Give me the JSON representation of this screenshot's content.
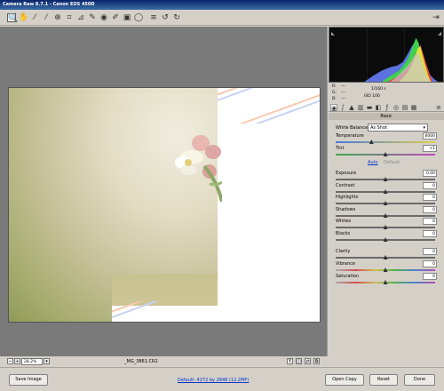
{
  "window": {
    "title": "Camera Raw 8.7.1  -  Canon EOS 450D"
  },
  "toolbar": {
    "tools": [
      {
        "name": "zoom-tool-icon",
        "glyph": "🔍"
      },
      {
        "name": "hand-tool-icon",
        "glyph": "✋"
      },
      {
        "name": "white-balance-tool-icon",
        "glyph": "⁄"
      },
      {
        "name": "color-sampler-tool-icon",
        "glyph": "⁄"
      },
      {
        "name": "target-adjustment-tool-icon",
        "glyph": "⊕"
      },
      {
        "name": "crop-tool-icon",
        "glyph": "⌗"
      },
      {
        "name": "straighten-tool-icon",
        "glyph": "⊿"
      },
      {
        "name": "spot-removal-tool-icon",
        "glyph": "✎"
      },
      {
        "name": "red-eye-tool-icon",
        "glyph": "◉"
      },
      {
        "name": "adjustment-brush-icon",
        "glyph": "✐"
      },
      {
        "name": "graduated-filter-icon",
        "glyph": "▣"
      },
      {
        "name": "radial-filter-icon",
        "glyph": "◯"
      },
      {
        "name": "preferences-icon",
        "glyph": "≡"
      },
      {
        "name": "rotate-ccw-icon",
        "glyph": "↺"
      },
      {
        "name": "rotate-cw-icon",
        "glyph": "↻"
      }
    ],
    "open_preview_icon": "⇥"
  },
  "readout": {
    "r_label": "R:",
    "g_label": "G:",
    "b_label": "B:",
    "r_value": "---",
    "g_value": "---",
    "b_value": "---",
    "shutter": "1/160 s",
    "iso": "ISO 100"
  },
  "panel": {
    "title": "Basic",
    "white_balance_label": "White Balance:",
    "white_balance_value": "As Shot",
    "auto_label": "Auto",
    "default_label": "Default",
    "sliders": [
      {
        "label": "Temperature",
        "value": "6000",
        "pos": 0.36
      },
      {
        "label": "Tint",
        "value": "+1",
        "pos": 0.5
      },
      {
        "label": "Exposure",
        "value": "0.00",
        "pos": 0.5
      },
      {
        "label": "Contrast",
        "value": "0",
        "pos": 0.5
      },
      {
        "label": "Highlights",
        "value": "0",
        "pos": 0.5
      },
      {
        "label": "Shadows",
        "value": "0",
        "pos": 0.5
      },
      {
        "label": "Whites",
        "value": "0",
        "pos": 0.5
      },
      {
        "label": "Blacks",
        "value": "0",
        "pos": 0.5
      },
      {
        "label": "Clarity",
        "value": "0",
        "pos": 0.5
      },
      {
        "label": "Vibrance",
        "value": "0",
        "pos": 0.5
      },
      {
        "label": "Saturation",
        "value": "0",
        "pos": 0.5
      }
    ]
  },
  "status": {
    "zoom": "28.2%",
    "filename": "_MG_3861.CR2"
  },
  "bottom": {
    "save_image": "Save Image",
    "workflow_link": "Default: 4272 by 2848 (12.2MP)",
    "open_copy": "Open Copy",
    "reset": "Reset",
    "done": "Done"
  },
  "colors": {
    "title_bar": "#0a246a",
    "link": "#0033cc"
  }
}
